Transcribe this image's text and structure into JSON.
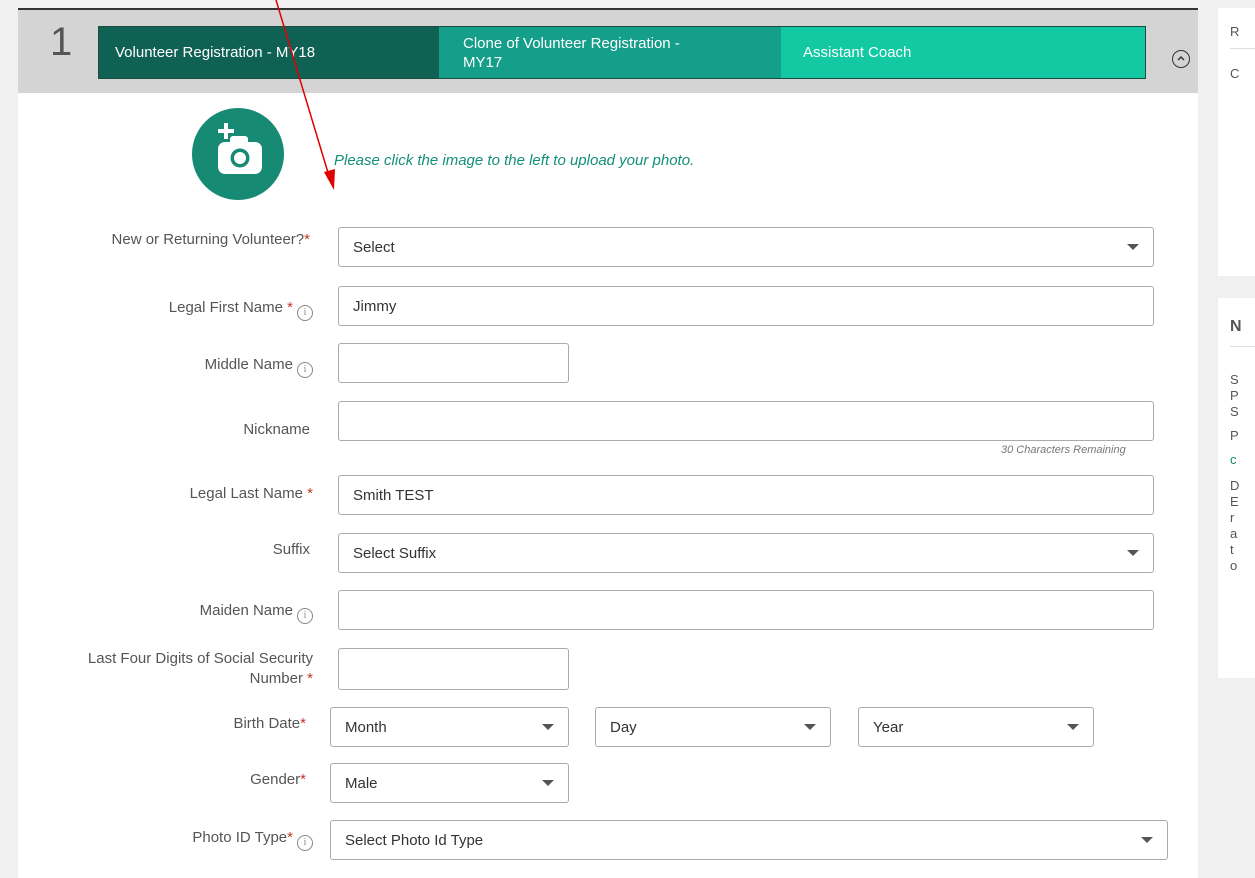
{
  "header": {
    "step_number": "1",
    "tabs": [
      {
        "label": "Volunteer Registration - MY18"
      },
      {
        "label": "Clone of Volunteer Registration - MY17"
      },
      {
        "label": "Assistant Coach"
      }
    ]
  },
  "photo": {
    "icon": "add-photo-camera-icon",
    "prompt": "Please click the image to the left to upload your photo."
  },
  "form": {
    "new_or_returning": {
      "label": "New or Returning Volunteer?",
      "value": "Select"
    },
    "first_name": {
      "label": "Legal First Name",
      "value": "Jimmy"
    },
    "middle_name": {
      "label": "Middle Name",
      "value": ""
    },
    "nickname": {
      "label": "Nickname",
      "value": "",
      "helper": "30 Characters Remaining"
    },
    "last_name": {
      "label": "Legal Last Name",
      "value": "Smith TEST"
    },
    "suffix": {
      "label": "Suffix",
      "value": "Select Suffix"
    },
    "maiden_name": {
      "label": "Maiden Name",
      "value": ""
    },
    "ssn_last4": {
      "label": "Last Four Digits of Social Security Number",
      "value": ""
    },
    "birth_date": {
      "label": "Birth Date",
      "month": "Month",
      "day": "Day",
      "year": "Year"
    },
    "gender": {
      "label": "Gender",
      "value": "Male"
    },
    "photo_id_type": {
      "label": "Photo ID Type",
      "value": "Select Photo Id Type"
    },
    "required_mark": "*",
    "info_icon": "i"
  },
  "sidebar": {
    "panel1_letters": [
      "R",
      "C"
    ],
    "panel2_heading": "N",
    "panel2_letters": [
      "S",
      "P",
      "S",
      "P",
      "c",
      "D",
      "E",
      "r",
      "a",
      "t",
      "o"
    ]
  },
  "colors": {
    "tab_dark": "#0f6154",
    "tab_mid": "#159e8a",
    "tab_light": "#12c9a4",
    "accent": "#168a73",
    "required": "#c0392b",
    "arrow": "#e00000"
  }
}
